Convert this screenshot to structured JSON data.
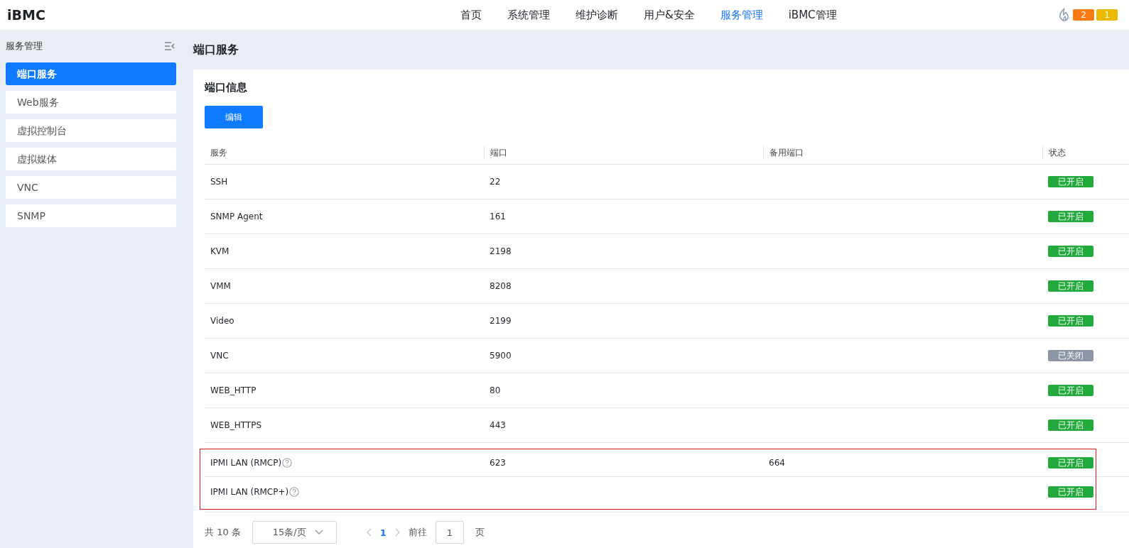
{
  "header": {
    "logo": "iBMC",
    "nav": [
      {
        "label": "首页",
        "selected": false
      },
      {
        "label": "系统管理",
        "selected": false
      },
      {
        "label": "维护诊断",
        "selected": false
      },
      {
        "label": "用户&安全",
        "selected": false
      },
      {
        "label": "服务管理",
        "selected": true
      },
      {
        "label": "iBMC管理",
        "selected": false
      }
    ],
    "alarms": [
      {
        "count": "2",
        "color": "#fa7a14"
      },
      {
        "count": "1",
        "color": "#ebba00"
      }
    ]
  },
  "sidebar": {
    "title": "服务管理",
    "items": [
      {
        "label": "端口服务",
        "selected": true
      },
      {
        "label": "Web服务",
        "selected": false
      },
      {
        "label": "虚拟控制台",
        "selected": false
      },
      {
        "label": "虚拟媒体",
        "selected": false
      },
      {
        "label": "VNC",
        "selected": false
      },
      {
        "label": "SNMP",
        "selected": false
      }
    ]
  },
  "page_title": "端口服务",
  "card": {
    "title": "端口信息",
    "edit_button": "编辑",
    "table": {
      "columns": [
        "服务",
        "端口",
        "备用端口",
        "状态"
      ],
      "rows": [
        {
          "service": "SSH",
          "port": "22",
          "backup_port": "",
          "status": {
            "text": "已开启",
            "kind": "on"
          },
          "help": false,
          "highlighted": false
        },
        {
          "service": "SNMP Agent",
          "port": "161",
          "backup_port": "",
          "status": {
            "text": "已开启",
            "kind": "on"
          },
          "help": false,
          "highlighted": false
        },
        {
          "service": "KVM",
          "port": "2198",
          "backup_port": "",
          "status": {
            "text": "已开启",
            "kind": "on"
          },
          "help": false,
          "highlighted": false
        },
        {
          "service": "VMM",
          "port": "8208",
          "backup_port": "",
          "status": {
            "text": "已开启",
            "kind": "on"
          },
          "help": false,
          "highlighted": false
        },
        {
          "service": "Video",
          "port": "2199",
          "backup_port": "",
          "status": {
            "text": "已开启",
            "kind": "on"
          },
          "help": false,
          "highlighted": false
        },
        {
          "service": "VNC",
          "port": "5900",
          "backup_port": "",
          "status": {
            "text": "已关闭",
            "kind": "off"
          },
          "help": false,
          "highlighted": false
        },
        {
          "service": "WEB_HTTP",
          "port": "80",
          "backup_port": "",
          "status": {
            "text": "已开启",
            "kind": "on"
          },
          "help": false,
          "highlighted": false
        },
        {
          "service": "WEB_HTTPS",
          "port": "443",
          "backup_port": "",
          "status": {
            "text": "已开启",
            "kind": "on"
          },
          "help": false,
          "highlighted": false
        },
        {
          "service": "IPMI LAN (RMCP)",
          "port": "623",
          "backup_port": "664",
          "status": {
            "text": "已开启",
            "kind": "on"
          },
          "help": true,
          "highlighted": true
        },
        {
          "service": "IPMI LAN (RMCP+)",
          "port": "",
          "backup_port": "",
          "status": {
            "text": "已开启",
            "kind": "on"
          },
          "help": true,
          "highlighted": true
        }
      ]
    },
    "pagination": {
      "total": "共 10 条",
      "page_size": "15条/页",
      "current_page": "1",
      "goto_label": "前往",
      "goto_value": "1",
      "page_unit": "页"
    }
  }
}
